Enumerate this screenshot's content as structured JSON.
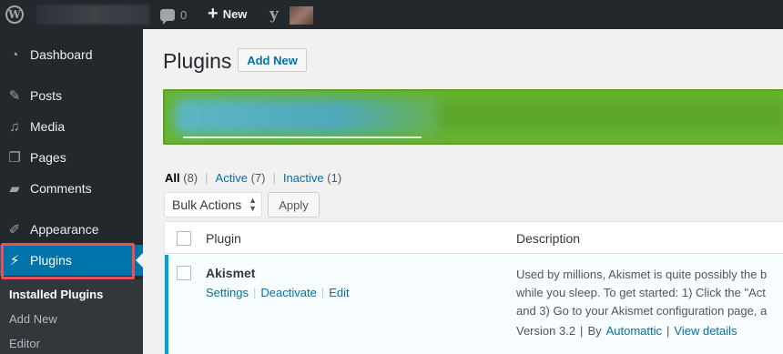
{
  "admin_bar": {
    "logo_glyph": "W",
    "comments_count": "0",
    "new_label": "New",
    "yoast_glyph": "y"
  },
  "sidebar": {
    "items": [
      {
        "label": "Dashboard",
        "icon": "dashboard-icon",
        "glyph": "◔"
      },
      {
        "label": "Posts",
        "icon": "pin-icon",
        "glyph": "✎"
      },
      {
        "label": "Media",
        "icon": "media-icon",
        "glyph": "♫"
      },
      {
        "label": "Pages",
        "icon": "pages-icon",
        "glyph": "❐"
      },
      {
        "label": "Comments",
        "icon": "comments-icon",
        "glyph": "▰"
      },
      {
        "label": "Appearance",
        "icon": "brush-icon",
        "glyph": "✐"
      },
      {
        "label": "Plugins",
        "icon": "plugin-icon",
        "glyph": "⚡"
      }
    ],
    "submenu": [
      "Installed Plugins",
      "Add New",
      "Editor"
    ]
  },
  "main": {
    "title": "Plugins",
    "add_new_label": "Add New",
    "filters": {
      "all_label": "All",
      "all_count": "(8)",
      "active_label": "Active",
      "active_count": "(7)",
      "inactive_label": "Inactive",
      "inactive_count": "(1)",
      "separator": "|"
    },
    "bulk_actions": {
      "selected": "Bulk Actions",
      "apply_label": "Apply"
    },
    "table": {
      "headers": [
        "Plugin",
        "Description"
      ],
      "rows": [
        {
          "name": "Akismet",
          "actions": [
            "Settings",
            "Deactivate",
            "Edit"
          ],
          "description_lines": [
            "Used by millions, Akismet is quite possibly the b",
            "while you sleep. To get started: 1) Click the \"Act",
            "and 3) Go to your Akismet configuration page, a"
          ],
          "version": "Version 3.2",
          "by_label": "By",
          "author": "Automattic",
          "view_details": "View details"
        }
      ]
    }
  },
  "colors": {
    "admin_dark": "#23282d",
    "accent_blue": "#0073aa",
    "notice_green": "#66b32e",
    "highlight_red": "#ef4f4f",
    "active_row_border": "#00a0d2"
  }
}
